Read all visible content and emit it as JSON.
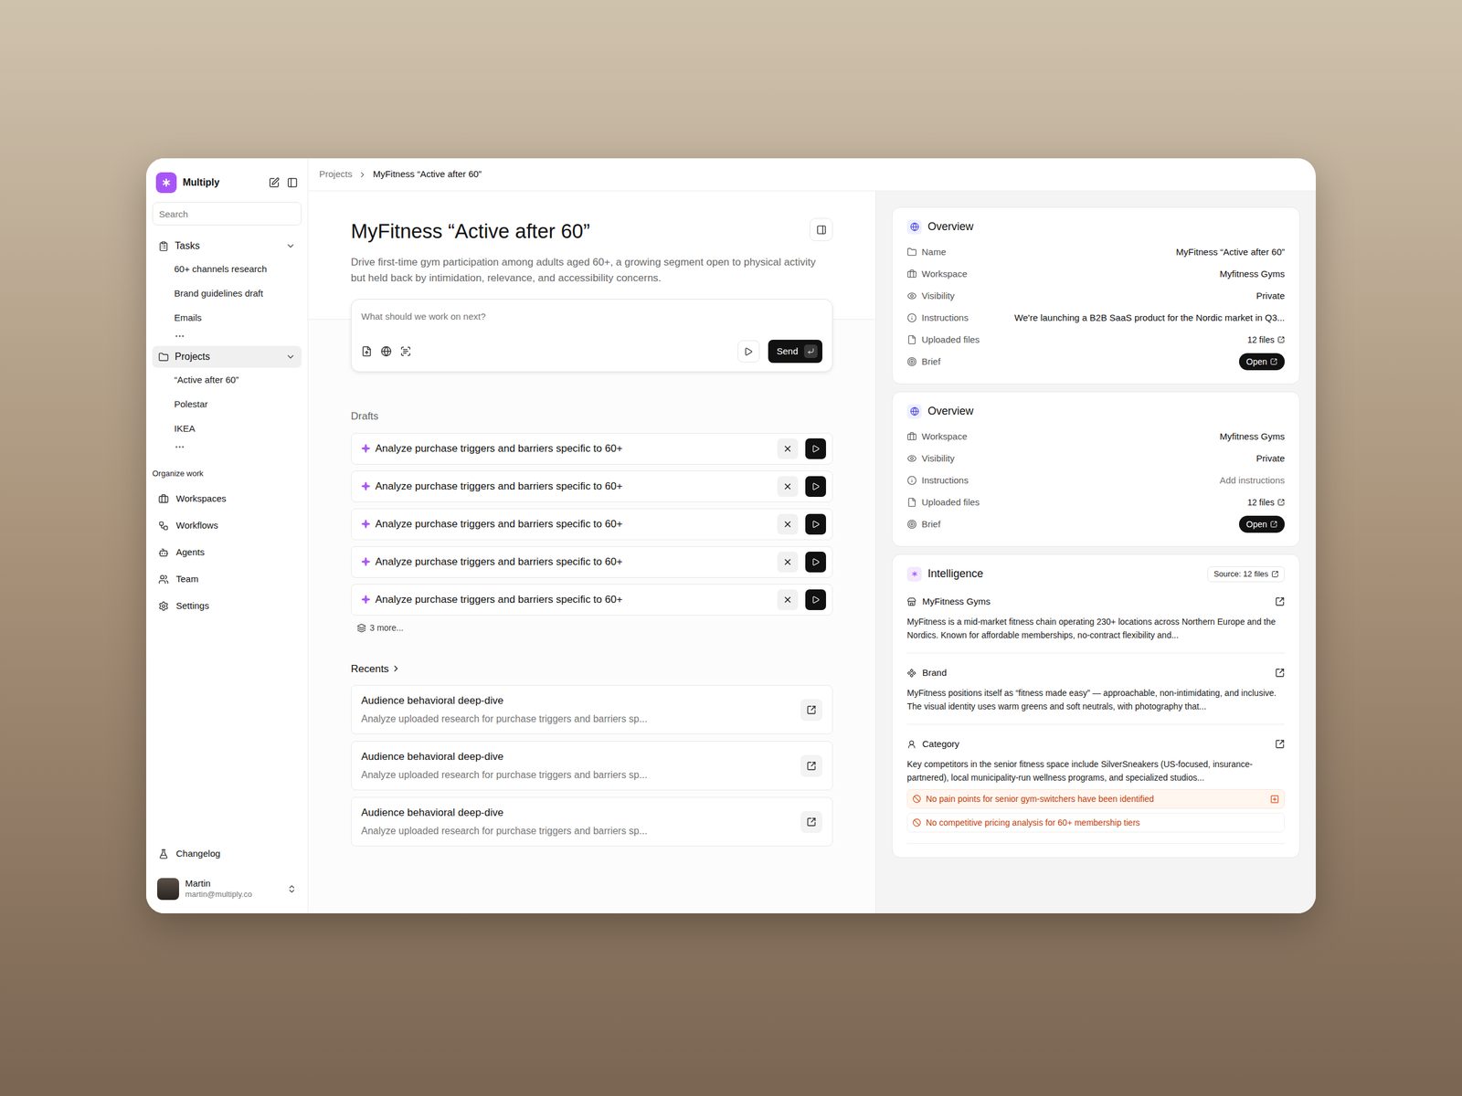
{
  "sidebar": {
    "app_name": "Multiply",
    "search_placeholder": "Search",
    "sections": [
      {
        "label": "Tasks",
        "expanded": true,
        "selected": false,
        "items": [
          "60+ channels research",
          "Brand guidelines draft",
          "Emails"
        ]
      },
      {
        "label": "Projects",
        "expanded": true,
        "selected": true,
        "items": [
          "“Active after 60”",
          "Polestar",
          "IKEA"
        ]
      }
    ],
    "organize_label": "Organize work",
    "nav": [
      "Workspaces",
      "Workflows",
      "Agents",
      "Team",
      "Settings"
    ],
    "changelog": "Changelog",
    "user": {
      "name": "Martin",
      "email": "martin@multiply.co"
    }
  },
  "breadcrumb": [
    "Projects",
    "MyFitness “Active after 60”"
  ],
  "project": {
    "title": "MyFitness “Active after 60”",
    "description": "Drive first-time gym participation among adults aged 60+, a growing segment open to physical activity but held back by intimidation, relevance, and accessibility concerns."
  },
  "composer": {
    "placeholder": "What should we work on next?",
    "send": "Send"
  },
  "drafts": {
    "label": "Drafts",
    "items": [
      "Analyze purchase triggers and barriers specific to 60+",
      "Analyze purchase triggers and barriers specific to 60+",
      "Analyze purchase triggers and barriers specific to 60+",
      "Analyze purchase triggers and barriers specific to 60+",
      "Analyze purchase triggers and barriers specific to 60+"
    ],
    "more": "3 more..."
  },
  "recents": {
    "label": "Recents",
    "items": [
      {
        "title": "Audience behavioral deep-dive",
        "subtitle": "Analyze uploaded research for purchase triggers and barriers sp..."
      },
      {
        "title": "Audience behavioral deep-dive",
        "subtitle": "Analyze uploaded research for purchase triggers and barriers sp..."
      },
      {
        "title": "Audience behavioral deep-dive",
        "subtitle": "Analyze uploaded research for purchase triggers and barriers sp..."
      }
    ]
  },
  "overview_cards": [
    {
      "title": "Overview",
      "rows": [
        {
          "label": "Name",
          "value": "MyFitness “Active after 60”",
          "kind": "text"
        },
        {
          "label": "Workspace",
          "value": "Myfitness Gyms",
          "kind": "text"
        },
        {
          "label": "Visibility",
          "value": "Private",
          "kind": "text"
        },
        {
          "label": "Instructions",
          "value": "We're launching a B2B SaaS product for the Nordic market in Q3...",
          "kind": "text"
        },
        {
          "label": "Uploaded files",
          "value": "12 files",
          "kind": "link"
        },
        {
          "label": "Brief",
          "value": "Open",
          "kind": "button"
        }
      ]
    },
    {
      "title": "Overview",
      "rows": [
        {
          "label": "Workspace",
          "value": "Myfitness Gyms",
          "kind": "text"
        },
        {
          "label": "Visibility",
          "value": "Private",
          "kind": "text"
        },
        {
          "label": "Instructions",
          "value": "Add instructions",
          "kind": "placeholder"
        },
        {
          "label": "Uploaded files",
          "value": "12 files",
          "kind": "link"
        },
        {
          "label": "Brief",
          "value": "Open",
          "kind": "button"
        }
      ]
    }
  ],
  "intelligence": {
    "title": "Intelligence",
    "source": "Source: 12 files",
    "sections": [
      {
        "title": "MyFitness Gyms",
        "text": "MyFitness is a mid-market fitness chain operating 230+ locations across Northern Europe and the Nordics. Known for affordable memberships, no-contract flexibility and...",
        "warnings": []
      },
      {
        "title": "Brand",
        "text": "MyFitness positions itself as “fitness made easy” — approachable, non-intimidating, and inclusive. The visual identity uses warm greens and soft neutrals, with photography that...",
        "warnings": []
      },
      {
        "title": "Category",
        "text": "Key competitors in the senior fitness space include SilverSneakers (US-focused, insurance-partnered), local municipality-run wellness programs, and specialized studios...",
        "warnings": [
          {
            "text": "No pain points for senior gym-switchers have been identified",
            "highlighted": true
          },
          {
            "text": "No competitive pricing analysis for 60+ membership tiers",
            "highlighted": false
          }
        ]
      }
    ]
  }
}
